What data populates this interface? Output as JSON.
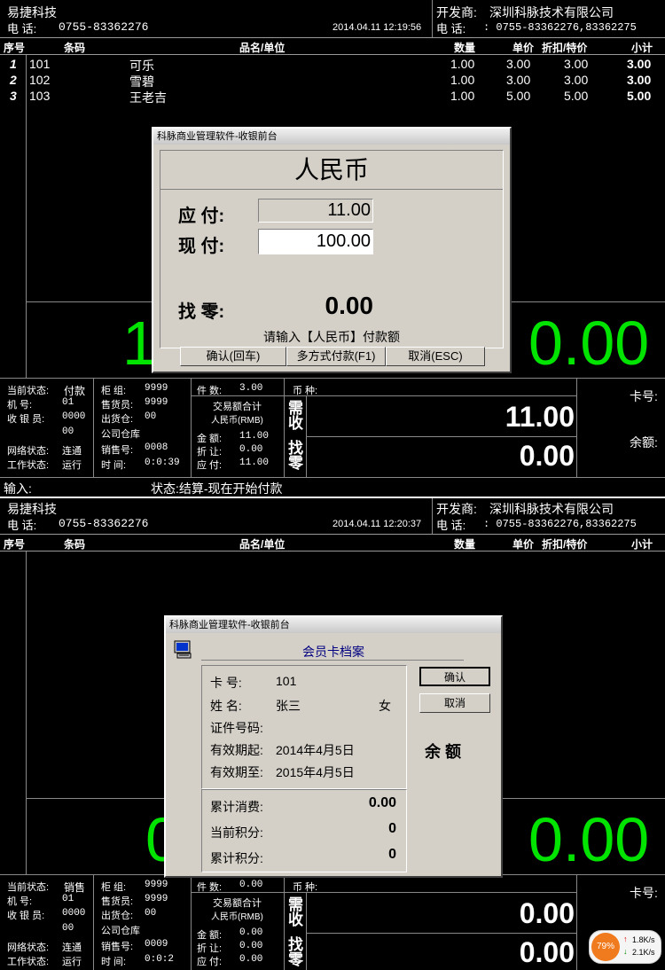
{
  "screen1": {
    "header": {
      "company": "易捷科技",
      "phone_label": "电  话:",
      "phone": "0755-83362276",
      "datetime": "2014.04.11 12:19:56",
      "developer_label": "开发商:",
      "developer": "深圳科脉技术有限公司",
      "dev_phone_label": "电  话:",
      "dev_phone": ": 0755-83362276,83362275"
    },
    "columns": [
      "序号",
      "条码",
      "品名/单位",
      "数量",
      "单价",
      "折扣/特价",
      "小计"
    ],
    "rows": [
      {
        "no": "1",
        "barcode": "101",
        "name": "可乐",
        "qty": "1.00",
        "price": "3.00",
        "disc": "3.00",
        "subtotal": "3.00"
      },
      {
        "no": "2",
        "barcode": "102",
        "name": "雪碧",
        "qty": "1.00",
        "price": "3.00",
        "disc": "3.00",
        "subtotal": "3.00"
      },
      {
        "no": "3",
        "barcode": "103",
        "name": "王老吉",
        "qty": "1.00",
        "price": "5.00",
        "disc": "5.00",
        "subtotal": "5.00"
      }
    ],
    "big_left": "1",
    "big_right": "0.00",
    "status": {
      "cur_state_label": "当前状态:",
      "cur_state": "付款",
      "machine_label": "机    号:",
      "machine": "01",
      "cashier_label": "收 银 员:",
      "cashier": "0000",
      "cashier2": "00",
      "net_label": "网络状态:",
      "net": "连通",
      "work_label": "工作状态:",
      "work": "运行",
      "counter_label": "柜  组:",
      "counter": "9999",
      "seller_label": "售货员:",
      "seller": "9999",
      "warehouse_label": "出货仓:",
      "warehouse": "00",
      "warehouse_name": "公司仓库",
      "sale_no_label": "销售号:",
      "sale_no": "0008",
      "time_label": "时  间:",
      "time": "0:0:39",
      "count_label": "件  数:",
      "count": "3.00",
      "total_title": "交易额合计",
      "currency_rmb": "人民币(RMB)",
      "amount_label": "金  额:",
      "amount": "11.00",
      "discount_label": "折  让:",
      "discount": "0.00",
      "payable_label": "应  付:",
      "payable": "11.00",
      "currency_label": "币  种:",
      "need_label": "需收",
      "change_label": "找零",
      "need_value": "11.00",
      "change_value": "0.00",
      "card_label": "卡号:",
      "balance_label": "余额:"
    },
    "input_label": "输入:",
    "state_text": "状态:结算-现在开始付款",
    "dialog": {
      "title": "科脉商业管理软件-收银前台",
      "currency": "人民币",
      "payable_label": "应  付:",
      "payable": "11.00",
      "paid_label": "现  付:",
      "paid": "100.00",
      "change_label": "找  零:",
      "change": "0.00",
      "prompt": "请输入【人民币】付款额",
      "ok": "确认(回车)",
      "multi": "多方式付款(F1)",
      "cancel": "取消(ESC)"
    }
  },
  "screen2": {
    "header": {
      "company": "易捷科技",
      "phone_label": "电  话:",
      "phone": "0755-83362276",
      "datetime": "2014.04.11 12:20:37",
      "developer_label": "开发商:",
      "developer": "深圳科脉技术有限公司",
      "dev_phone_label": "电  话:",
      "dev_phone": ": 0755-83362276,83362275"
    },
    "columns": [
      "序号",
      "条码",
      "品名/单位",
      "数量",
      "单价",
      "折扣/特价",
      "小计"
    ],
    "big_left": "0",
    "big_right": "0.00",
    "status": {
      "cur_state_label": "当前状态:",
      "cur_state": "销售",
      "machine_label": "机    号:",
      "machine": "01",
      "cashier_label": "收 银 员:",
      "cashier": "0000",
      "cashier2": "00",
      "net_label": "网络状态:",
      "net": "连通",
      "work_label": "工作状态:",
      "work": "运行",
      "counter_label": "柜  组:",
      "counter": "9999",
      "seller_label": "售货员:",
      "seller": "9999",
      "warehouse_label": "出货仓:",
      "warehouse": "00",
      "warehouse_name": "公司仓库",
      "sale_no_label": "销售号:",
      "sale_no": "0009",
      "time_label": "时  间:",
      "time": "0:0:2",
      "count_label": "件  数:",
      "count": "0.00",
      "total_title": "交易额合计",
      "currency_rmb": "人民币(RMB)",
      "amount_label": "金  额:",
      "amount": "0.00",
      "discount_label": "折  让:",
      "discount": "0.00",
      "payable_label": "应  付:",
      "payable": "0.00",
      "currency_label": "币  种:",
      "need_label": "需收",
      "change_label": "找零",
      "need_value": "0.00",
      "change_value": "0.00",
      "card_label": "卡号:"
    },
    "dialog": {
      "title": "科脉商业管理软件-收银前台",
      "heading": "会员卡档案",
      "card_no_label": "卡    号:",
      "card_no": "101",
      "name_label": "姓    名:",
      "name": "张三",
      "gender": "女",
      "id_label": "证件号码:",
      "valid_from_label": "有效期起:",
      "valid_from": "2014年4月5日",
      "valid_to_label": "有效期至:",
      "valid_to": "2015年4月5日",
      "total_spend_label": "累计消费:",
      "total_spend": "0.00",
      "cur_points_label": "当前积分:",
      "cur_points": "0",
      "total_points_label": "累计积分:",
      "total_points": "0",
      "ok": "确认",
      "cancel": "取消",
      "balance_label": "余  额"
    },
    "tray": {
      "percent": "79%",
      "up": "1.8K/s",
      "down": "2.1K/s"
    }
  },
  "colors": {
    "green": "#00e400",
    "dialog_bg": "#d4d0c8",
    "heading_blue": "#000080"
  }
}
